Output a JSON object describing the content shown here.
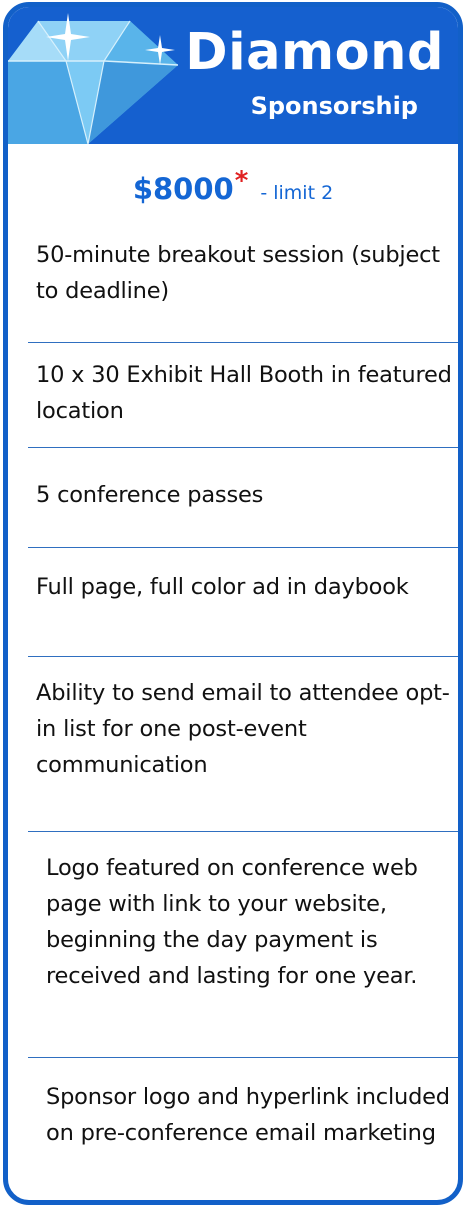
{
  "header": {
    "title": "Diamond",
    "subtitle": "Sponsorship",
    "background_color": "#1560cf",
    "decoration_icon": "diamond-gem-icon with sparkle-icons"
  },
  "pricing": {
    "price": "$8000",
    "asterisk": "*",
    "limit": "- limit 2",
    "price_color": "#1466d4",
    "asterisk_color": "#e02121"
  },
  "benefits": [
    "50-minute breakout session (subject to deadline)",
    "10 x 30 Exhibit Hall Booth in featured location",
    "5 conference passes",
    "Full page, full color ad in daybook",
    "Ability to send email to attendee opt-in list for one post-event communication",
    "Logo featured on conference web page with link to your website, beginning the day payment is received and lasting for one year.",
    "Sponsor logo and hyperlink included on pre-conference email marketing"
  ],
  "border_color": "#1260c8"
}
